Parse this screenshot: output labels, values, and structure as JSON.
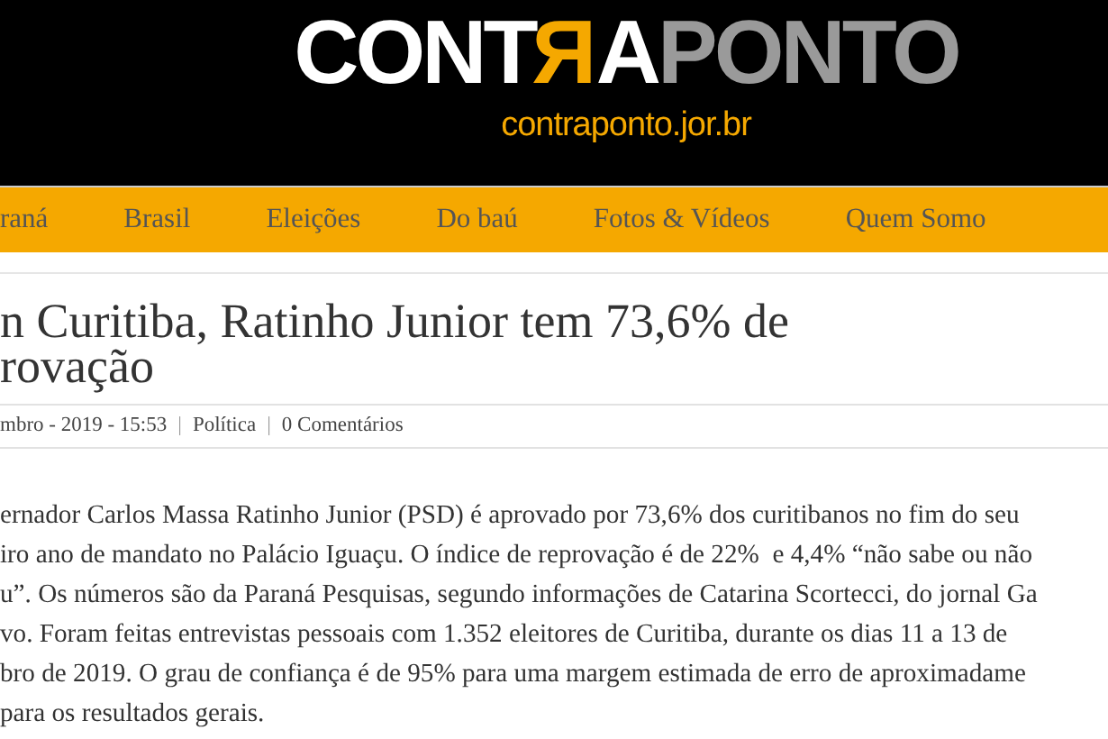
{
  "header": {
    "logo_parts": [
      {
        "text": "CONT",
        "color": "#ffffff",
        "mirrored": false
      },
      {
        "text": "R",
        "color": "#f5a800",
        "mirrored": true
      },
      {
        "text": "A",
        "color": "#ffffff",
        "mirrored": false
      },
      {
        "text": "PONTO",
        "color": "#9a9a9a",
        "mirrored": false
      }
    ],
    "domain": "contraponto.jor.br"
  },
  "nav": {
    "items": [
      {
        "label": "raná"
      },
      {
        "label": "Brasil"
      },
      {
        "label": "Eleições"
      },
      {
        "label": "Do baú"
      },
      {
        "label": "Fotos & Vídeos"
      },
      {
        "label": "Quem Somo"
      }
    ]
  },
  "article": {
    "title_lines": [
      "n Curitiba, Ratinho Junior tem 73,6% de",
      "rovação"
    ],
    "meta": {
      "date": "mbro - 2019 - 15:53",
      "separator_1": "|",
      "category": "Política",
      "separator_2": "|",
      "comments": "0 Comentários"
    },
    "body_lines": [
      "ernador Carlos Massa Ratinho Junior (PSD) é aprovado por 73,6% dos curitibanos no fim do seu",
      "iro ano de mandato no Palácio Iguaçu. O índice de reprovação é de 22%  e 4,4% “não sabe ou não",
      "u”. Os números são da Paraná Pesquisas, segundo informações de Catarina Scortecci, do jornal Ga",
      "vo. Foram feitas entrevistas pessoais com 1.352 eleitores de Curitiba, durante os dias 11 a 13 de",
      "bro de 2019. O grau de confiança é de 95% para uma margem estimada de erro de aproximadame",
      "para os resultados gerais."
    ]
  }
}
